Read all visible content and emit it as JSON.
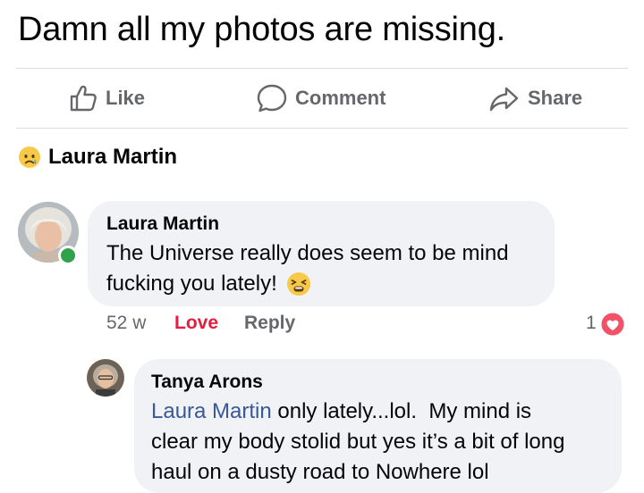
{
  "post": {
    "text": "Damn all my photos are missing."
  },
  "actions": {
    "like": "Like",
    "comment": "Comment",
    "share": "Share"
  },
  "reaction": {
    "emoji_icon": "sad-cry-emoji",
    "name": "Laura Martin"
  },
  "comment": {
    "author": "Laura Martin",
    "line1": "The Universe really does seem to be mind",
    "line2": "fucking you lately!",
    "emoji_icon": "tired-face-emoji",
    "time": "52 w",
    "love": "Love",
    "reply": "Reply",
    "reaction_count": "1",
    "reaction_icon": "heart-reaction-icon"
  },
  "reply": {
    "author": "Tanya Arons",
    "mention": "Laura Martin",
    "line1_rest": " only lately...lol.  My mind is",
    "line2": "clear my body stolid but yes it’s a bit of long",
    "line3": "haul on a dusty road to Nowhere lol"
  },
  "colors": {
    "love": "#e41e3f",
    "mention": "#385898",
    "muted": "#65676b",
    "bubble": "#f0f2f5",
    "online": "#31a24c"
  }
}
